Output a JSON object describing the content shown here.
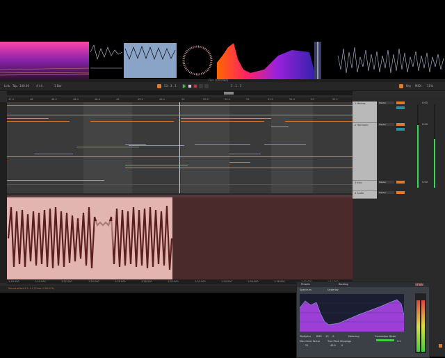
{
  "window": {
    "title": "File: [Untitled]"
  },
  "toolbar": {
    "link": "Link",
    "tap": "Tap",
    "bpm": "140.00",
    "sig": "4 / 4",
    "bar": "1 Bar",
    "position": "53 . 3 . 1",
    "key": "Key",
    "midi": "MIDI",
    "cpu": "11%"
  },
  "ruler": {
    "ticks": [
      "47.4",
      "48",
      "48.2",
      "48.4",
      "48.6",
      "49",
      "49.2",
      "49.4",
      "50",
      "50.2",
      "50.4",
      "51",
      "51.2",
      "51.4",
      "52",
      "52.2"
    ]
  },
  "bottom_ruler": {
    "ticks": [
      "1:18.000",
      "1:20.000",
      "1:22.000",
      "1:24.000",
      "1:26.000",
      "1:28.000",
      "1:30.000",
      "1:32.000",
      "1:34.000",
      "1:36.000",
      "1:38.000",
      "1:40.000",
      "1:42.000"
    ]
  },
  "tracks": [
    {
      "name": "1 Mellow",
      "routing": "Master",
      "vol": "0.00"
    },
    {
      "name": "2 Harmonic",
      "routing": "Master",
      "vol": "0.00"
    },
    {
      "name": "3 Kick",
      "routing": "Master",
      "vol": "0.00"
    },
    {
      "name": "4 Audio",
      "routing": "Master",
      "vol": "0.00"
    }
  ],
  "plugin": {
    "preset": "Presets",
    "routing": "Routing",
    "title": "SPAN",
    "mode": "Spectrum",
    "underlay": "Underlay",
    "stats_label": "Statistics",
    "rms_label": "RMS",
    "rms_value": "-15",
    "rms_value2": "-9",
    "max_crest_label": "Max Crest Factor",
    "max_crest_value": "21",
    "true_peak_label": "True Peak Clippings",
    "true_peak_value": "49.0",
    "true_peak_val2": "0",
    "metering_label": "Metering",
    "correlation_label": "Correlation Meter",
    "correlation_value": "0.1"
  },
  "status": {
    "text": "Sound effect 4-1-1-1 (Time: 0:00.071)"
  },
  "master": {
    "label": "Master"
  },
  "colors": {
    "accent": "#e27a2a",
    "teal": "#2a8fa0",
    "audio_selected": "#e3b5b0",
    "spectrum": "#9b3fd6"
  }
}
